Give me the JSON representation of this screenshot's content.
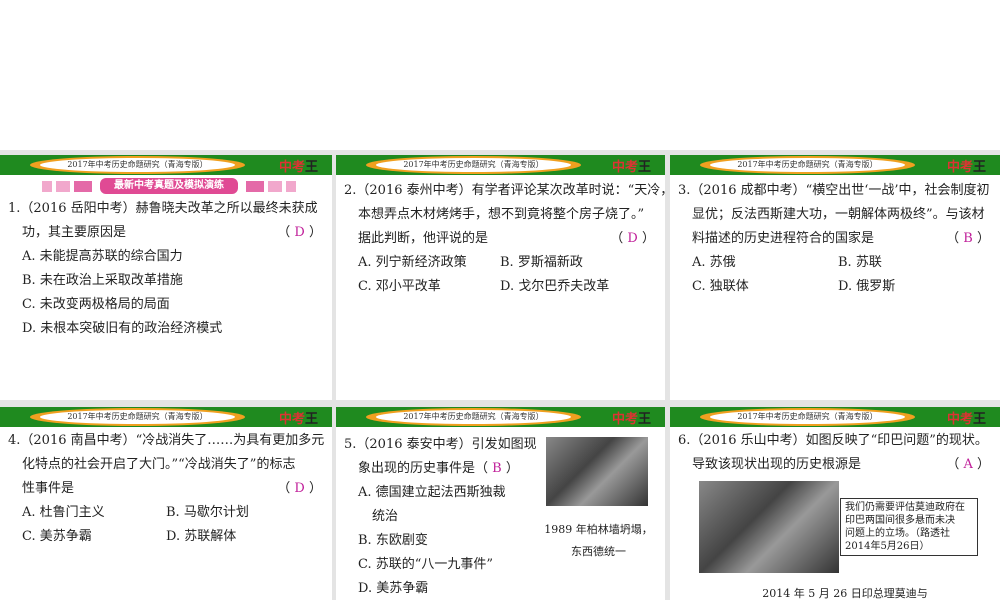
{
  "header_title": "2017年中考历史命题研究（青海专版）",
  "logo_text": "中考王",
  "banner": "最新中考真题及模拟演练",
  "slides": [
    {
      "q1": "1.（2016 岳阳中考）赫鲁晓夫改革之所以最终未获成",
      "q2": "功，其主要原因是",
      "answer": "D",
      "options": [
        "A. 未能提高苏联的综合国力",
        "B. 未在政治上采取改革措施",
        "C. 未改变两极格局的局面",
        "D. 未根本突破旧有的政治经济模式"
      ]
    },
    {
      "q1": "2.（2016 泰州中考）有学者评论某次改革时说：“天冷，",
      "q2": "本想弄点木材烤烤手，想不到竟将整个房子烧了。”",
      "q3": "据此判断，他评说的是",
      "answer": "D",
      "options": [
        "A. 列宁新经济政策",
        "B. 罗斯福新政",
        "C. 邓小平改革",
        "D. 戈尔巴乔夫改革"
      ]
    },
    {
      "q1": "3.（2016 成都中考）“横空出世‘一战’中，社会制度初",
      "q2": "显优；反法西斯建大功，一朝解体两极终”。与该材",
      "q3": "料描述的历史进程符合的国家是",
      "answer": "B",
      "options": [
        "A. 苏俄",
        "B. 苏联",
        "C. 独联体",
        "D. 俄罗斯"
      ]
    },
    {
      "q1": "4.（2016 南昌中考）“冷战消失了……为具有更加多元",
      "q2": "化特点的社会开启了大门。”“冷战消失了”的标志",
      "q3": "性事件是",
      "answer": "D",
      "options": [
        "A. 杜鲁门主义",
        "B. 马歇尔计划",
        "C. 美苏争霸",
        "D. 苏联解体"
      ]
    },
    {
      "q1": "5.（2016 泰安中考）引发如图现",
      "q2": "象出现的历史事件是（",
      "answer": "B",
      "options": [
        "A. 德国建立起法西斯独裁",
        "统治",
        "B. 东欧剧变",
        "C. 苏联的“八一九事件”",
        "D. 美苏争霸"
      ],
      "caption1": "1989 年柏林墙坍塌，",
      "caption2": "东西德统一"
    },
    {
      "q1": "6.（2016 乐山中考）如图反映了“印巴问题”的现状。",
      "q2": "导致该现状出现的历史根源是",
      "answer": "A",
      "quote": [
        "我们仍需要评估莫迪政府在",
        "印巴两国间很多悬而未决",
        "问题上的立场。（路透社",
        "2014年5月26日）"
      ],
      "caption1": "2014 年 5 月 26 日印总理莫迪与"
    }
  ]
}
